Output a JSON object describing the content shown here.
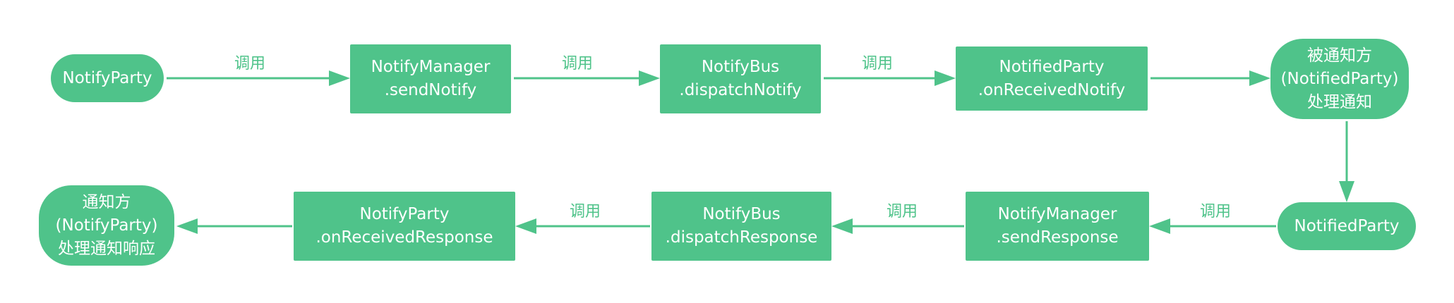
{
  "colors": {
    "accent": "#4fc38a",
    "text": "#ffffff",
    "label": "#4fc38a"
  },
  "nodes": [
    {
      "id": "notify-party",
      "text": "NotifyParty"
    },
    {
      "id": "notify-manager-send-notify",
      "text": "NotifyManager\n.sendNotify"
    },
    {
      "id": "notify-bus-dispatch-notify",
      "text": "NotifyBus\n.dispatchNotify"
    },
    {
      "id": "notified-party-on-received-notify",
      "text": "NotifiedParty\n.onReceivedNotify"
    },
    {
      "id": "notified-party-handle",
      "text": "被通知方\n(NotifiedParty)\n处理通知"
    },
    {
      "id": "notified-party",
      "text": "NotifiedParty"
    },
    {
      "id": "notify-manager-send-response",
      "text": "NotifyManager\n.sendResponse"
    },
    {
      "id": "notify-bus-dispatch-response",
      "text": "NotifyBus\n.dispatchResponse"
    },
    {
      "id": "notify-party-on-received-response",
      "text": "NotifyParty\n.onReceivedResponse"
    },
    {
      "id": "notify-party-handle-response",
      "text": "通知方\n(NotifyParty)\n处理通知响应"
    }
  ],
  "edges": [
    {
      "from": "notify-party",
      "to": "notify-manager-send-notify",
      "label": "调用"
    },
    {
      "from": "notify-manager-send-notify",
      "to": "notify-bus-dispatch-notify",
      "label": "调用"
    },
    {
      "from": "notify-bus-dispatch-notify",
      "to": "notified-party-on-received-notify",
      "label": "调用"
    },
    {
      "from": "notified-party-on-received-notify",
      "to": "notified-party-handle",
      "label": ""
    },
    {
      "from": "notified-party-handle",
      "to": "notified-party",
      "label": ""
    },
    {
      "from": "notified-party",
      "to": "notify-manager-send-response",
      "label": "调用"
    },
    {
      "from": "notify-manager-send-response",
      "to": "notify-bus-dispatch-response",
      "label": "调用"
    },
    {
      "from": "notify-bus-dispatch-response",
      "to": "notify-party-on-received-response",
      "label": "调用"
    },
    {
      "from": "notify-party-on-received-response",
      "to": "notify-party-handle-response",
      "label": ""
    }
  ]
}
